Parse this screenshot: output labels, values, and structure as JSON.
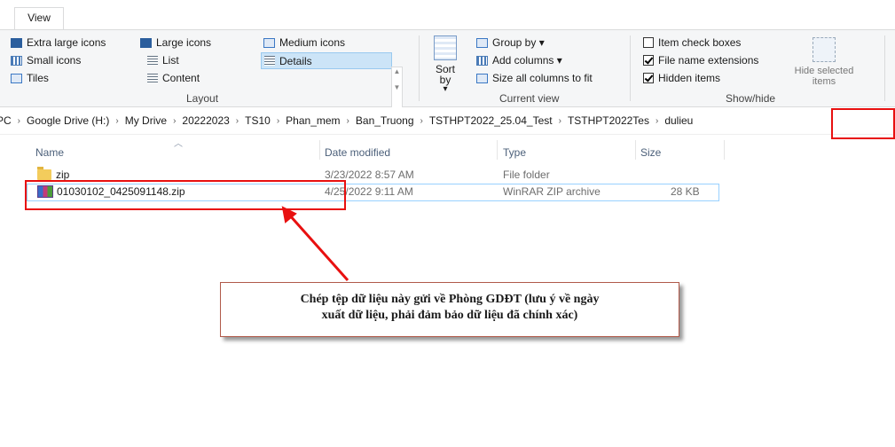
{
  "ribbon_tab": "View",
  "layout": {
    "items": [
      "Extra large icons",
      "Large icons",
      "Medium icons",
      "Small icons",
      "List",
      "Details",
      "Tiles",
      "Content"
    ],
    "selected": "Details",
    "group_label": "Layout"
  },
  "current_view": {
    "sort_label": "Sort by",
    "sort_arrow": "▾",
    "group_by": "Group by ▾",
    "add_columns": "Add columns ▾",
    "size_columns": "Size all columns to fit",
    "group_label": "Current view"
  },
  "show_hide": {
    "item_check_boxes": {
      "label": "Item check boxes",
      "checked": false
    },
    "file_name_extensions": {
      "label": "File name extensions",
      "checked": true
    },
    "hidden_items": {
      "label": "Hidden items",
      "checked": true
    },
    "hide_selected": "Hide selected items",
    "group_label": "Show/hide"
  },
  "breadcrumb": [
    "PC",
    "Google Drive (H:)",
    "My Drive",
    "20222023",
    "TS10",
    "Phan_mem",
    "Ban_Truong",
    "TSTHPT2022_25.04_Test",
    "TSTHPT2022Tes",
    "dulieu"
  ],
  "columns": {
    "name": "Name",
    "date": "Date modified",
    "type": "Type",
    "size": "Size"
  },
  "files": [
    {
      "name": "zip",
      "date": "3/23/2022 8:57 AM",
      "type": "File folder",
      "size": ""
    },
    {
      "name": "01030102_0425091148.zip",
      "date": "4/25/2022 9:11 AM",
      "type": "WinRAR ZIP archive",
      "size": "28 KB"
    }
  ],
  "callout": {
    "line1": "Chép tệp dữ liệu này gửi về Phòng GDĐT (lưu ý về ngày",
    "line2": "xuất dữ liệu, phải đảm bảo dữ liệu đã chính xác)"
  },
  "colors": {
    "annotation_red": "#e81010",
    "selection_blue": "#cce4f7"
  }
}
